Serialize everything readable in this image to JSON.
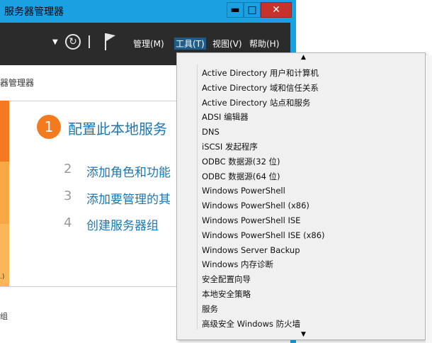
{
  "window": {
    "title": "服务器管理器",
    "min_label": "▬",
    "max_label": "□",
    "close_label": "✕"
  },
  "toolbar": {
    "dropdown_glyph": "▼",
    "refresh_glyph": "↻",
    "menus": {
      "manage": "管理(M)",
      "tools": "工具(T)",
      "view": "视图(V)",
      "help": "帮助(H)"
    }
  },
  "dashboard": {
    "title": "器管理器",
    "left_label": ".)",
    "bottom_label": "组"
  },
  "steps": [
    {
      "num": "1",
      "label": "配置此本地服务"
    },
    {
      "num": "2",
      "label": "添加角色和功能"
    },
    {
      "num": "3",
      "label": "添加要管理的其"
    },
    {
      "num": "4",
      "label": "创建服务器组"
    }
  ],
  "tools_menu": {
    "scroll_up": "▲",
    "scroll_down": "▼",
    "items": [
      "Active Directory 用户和计算机",
      "Active Directory 域和信任关系",
      "Active Directory 站点和服务",
      "ADSI 编辑器",
      "DNS",
      "iSCSI 发起程序",
      "ODBC 数据源(32 位)",
      "ODBC 数据源(64 位)",
      "Windows PowerShell",
      "Windows PowerShell (x86)",
      "Windows PowerShell ISE",
      "Windows PowerShell ISE (x86)",
      "Windows Server Backup",
      "Windows 内存诊断",
      "安全配置向导",
      "本地安全策略",
      "服务",
      "高级安全 Windows 防火墙"
    ]
  },
  "colors": {
    "accent_cyan": "#1ba1e2",
    "orange": "#f47a20",
    "link_blue": "#1b77b3",
    "toolbar_dark": "#2b2b2b"
  }
}
